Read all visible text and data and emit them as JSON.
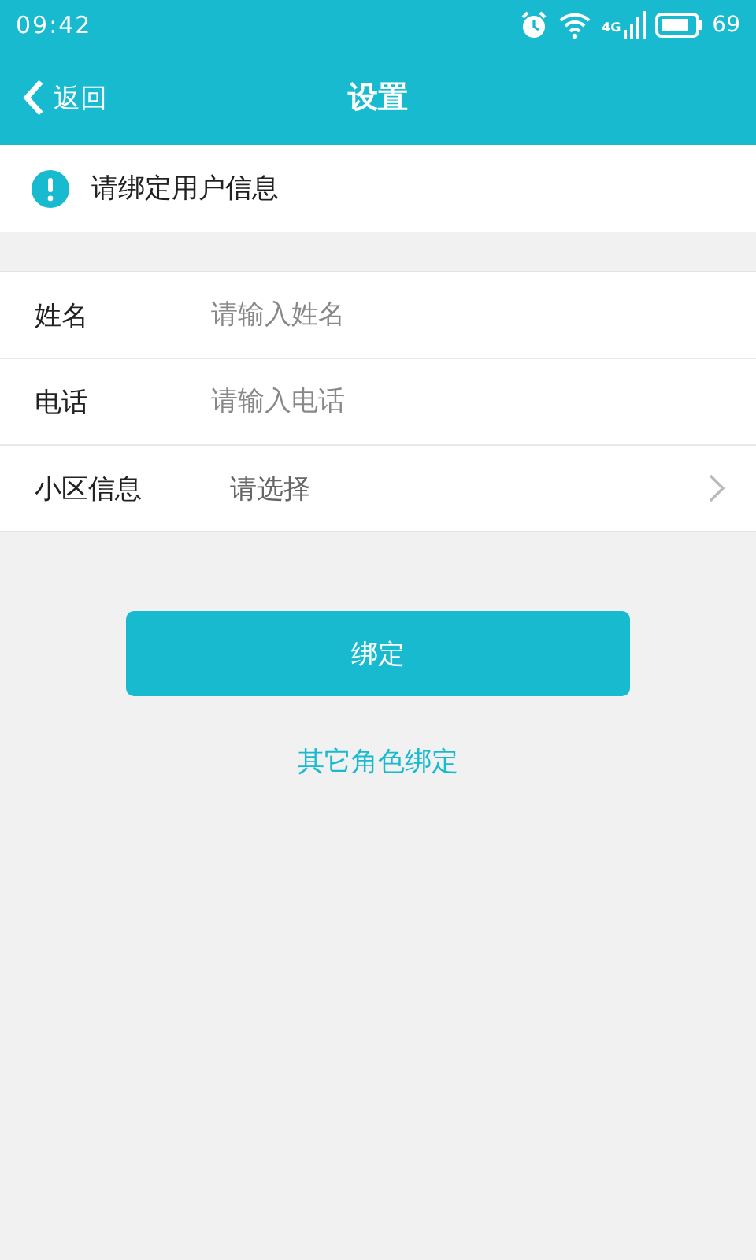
{
  "status_bar": {
    "time": "09:42",
    "network": "4G",
    "battery": "69"
  },
  "header": {
    "back": "返回",
    "title": "设置"
  },
  "notice": {
    "text": "请绑定用户信息"
  },
  "form": [
    {
      "kind": "input",
      "label": "姓名",
      "placeholder": "请输入姓名"
    },
    {
      "kind": "input",
      "label": "电话",
      "placeholder": "请输入电话"
    },
    {
      "kind": "select",
      "label": "小区信息",
      "placeholder": "请选择"
    }
  ],
  "primary_button": "绑定",
  "link": "其它角色绑定"
}
